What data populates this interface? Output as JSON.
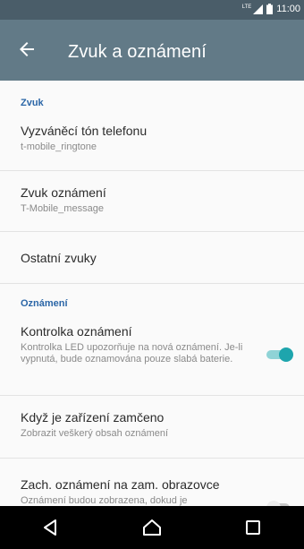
{
  "status_bar": {
    "network": "LTE",
    "time": "11:00"
  },
  "app_bar": {
    "title": "Zvuk a oznámení"
  },
  "sections": {
    "zvuk": {
      "header": "Zvuk",
      "items": [
        {
          "title": "Vyzváněcí tón telefonu",
          "subtitle": "t-mobile_ringtone"
        },
        {
          "title": "Zvuk oznámení",
          "subtitle": "T-Mobile_message"
        },
        {
          "title": "Ostatní zvuky"
        }
      ]
    },
    "oznameni": {
      "header": "Oznámení",
      "items": [
        {
          "title": "Kontrolka oznámení",
          "subtitle": "Kontrolka LED upozorňuje na nová oznámení. Je-li vypnutá, bude oznamována pouze slabá baterie.",
          "toggle": true
        },
        {
          "title": "Když je zařízení zamčeno",
          "subtitle": "Zobrazit veškerý obsah oznámení"
        },
        {
          "title": "Zach. oznámení na zam. obrazovce",
          "subtitle": "Oznámení budou zobrazena, dokud je",
          "toggle": false
        }
      ]
    }
  },
  "colors": {
    "status_bar": "#4a5d69",
    "app_bar": "#627a87",
    "section_header": "#2b66a7",
    "toggle_on": "#1ea5ad"
  },
  "nav_icons": [
    "back-triangle-icon",
    "home-icon",
    "recents-icon"
  ]
}
